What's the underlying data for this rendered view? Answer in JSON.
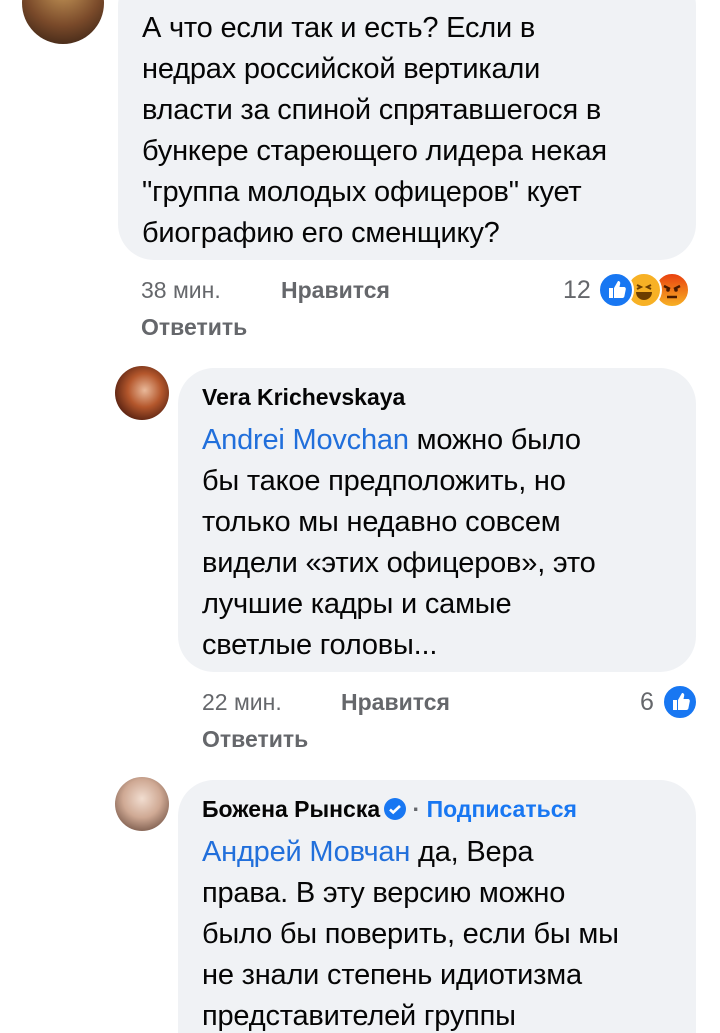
{
  "comments": [
    {
      "text": "А что если так и есть? Если в\nнедрах российской вертикали\nвласти за спиной спрятавшегося в\nбункере стареющего лидера некая\n\"группа молодых офицеров\" кует\nбиографию его сменщику?",
      "time": "38 мин.",
      "like_label": "Нравится",
      "reply_label": "Ответить",
      "reaction_count": "12"
    },
    {
      "author": "Vera Krichevskaya",
      "mention": "Andrei Movchan",
      "text": " можно было\nбы такое предположить, но\nтолько мы недавно совсем\nвидели «этих офицеров», это\nлучшие кадры и самые\nсветлые головы...",
      "time": "22 мин.",
      "like_label": "Нравится",
      "reply_label": "Ответить",
      "reaction_count": "6"
    },
    {
      "author": "Божена Рынска",
      "separator": "·",
      "subscribe_label": "Подписаться",
      "mention": "Андрей Мовчан",
      "text": " да, Вера\nправа. В эту версию можно\nбыло бы поверить, если бы мы\nне знали степень идиотизма\nпредставителей группы"
    }
  ],
  "icons": {
    "like": "like-icon",
    "haha": "haha-icon",
    "angry": "angry-icon",
    "verified": "verified-badge-icon"
  },
  "colors": {
    "bubble": "#f0f2f5",
    "mention": "#216fdb",
    "like": "#1877f2",
    "haha": "#f7b125",
    "angry": "#e9710f",
    "meta": "#65676b"
  }
}
